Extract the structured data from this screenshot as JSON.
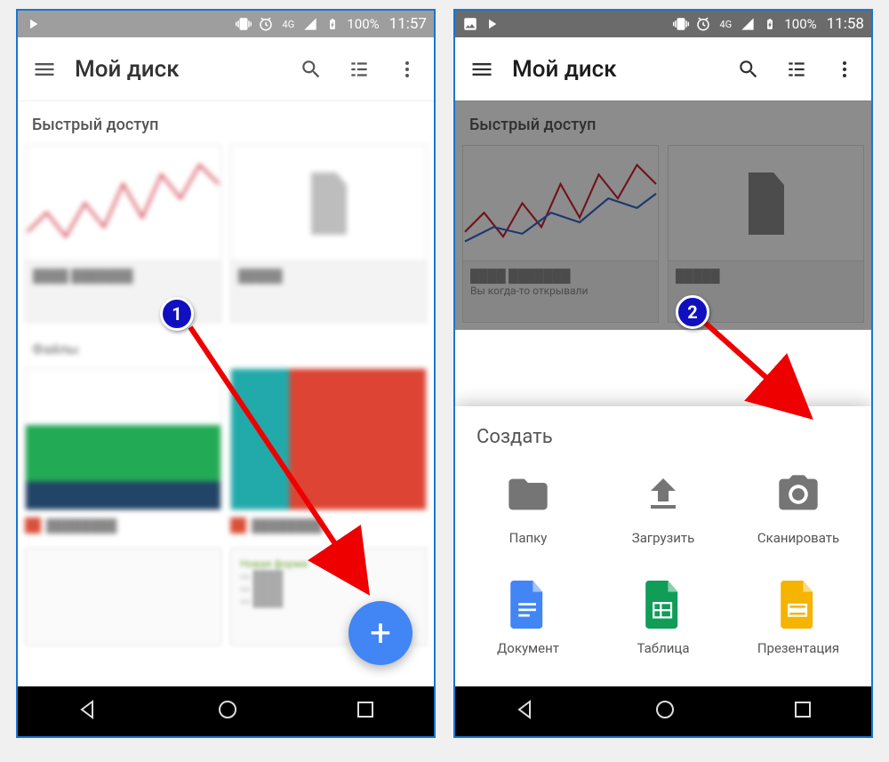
{
  "statusbar": {
    "battery_pct": "100%",
    "time_left": "11:57",
    "time_right": "11:58"
  },
  "appbar": {
    "title": "Мой диск"
  },
  "sections": {
    "quick_access": "Быстрый доступ",
    "files_label": "Файлы"
  },
  "fab": {
    "plus": "+"
  },
  "sheet": {
    "title": "Создать",
    "items": [
      {
        "label": "Папку"
      },
      {
        "label": "Загрузить"
      },
      {
        "label": "Сканировать"
      },
      {
        "label": "Документ"
      },
      {
        "label": "Таблица"
      },
      {
        "label": "Презентация"
      }
    ]
  },
  "annotations": {
    "badge1": "1",
    "badge2": "2"
  },
  "blurred": {
    "new_form": "Новая форма"
  }
}
